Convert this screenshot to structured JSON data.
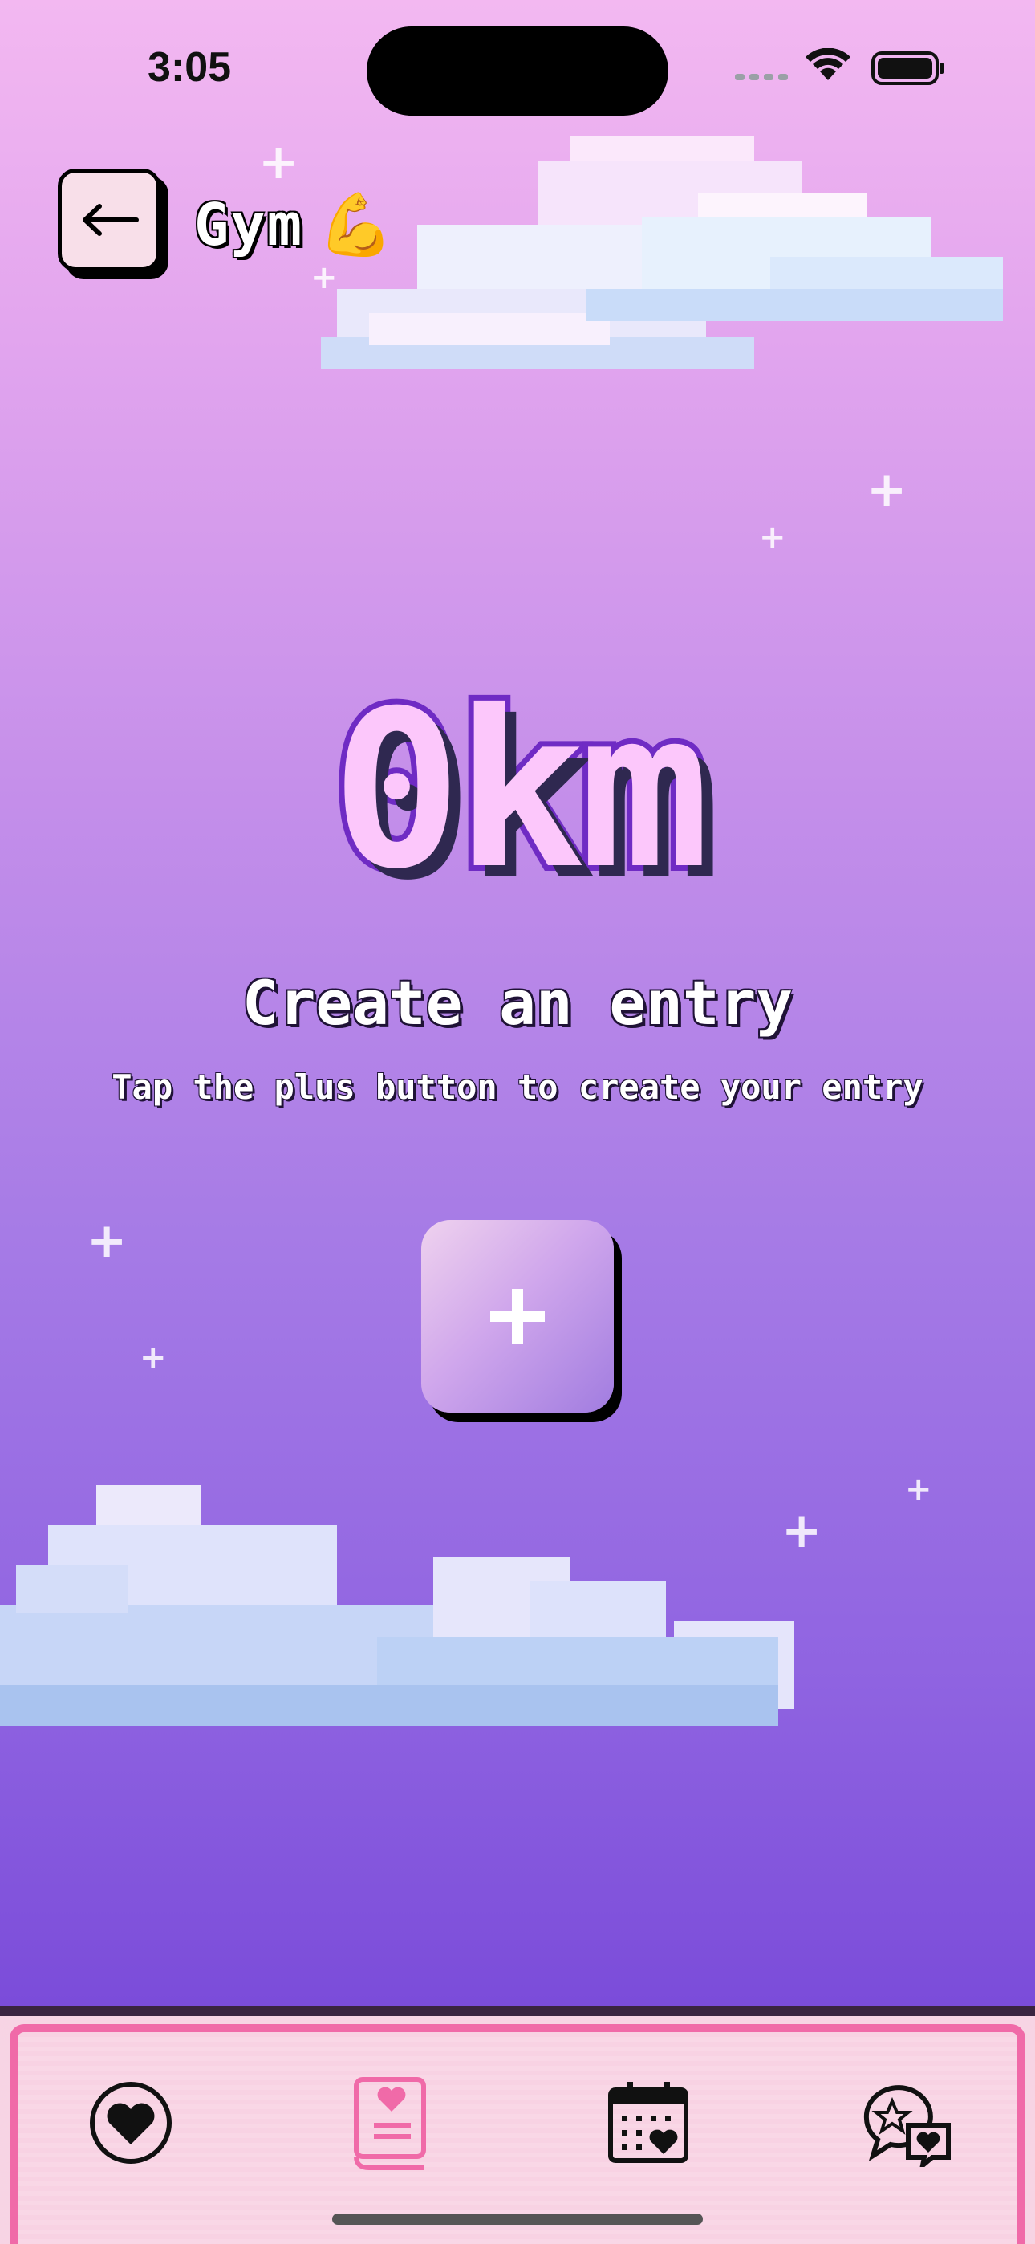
{
  "status_bar": {
    "time": "3:05"
  },
  "header": {
    "title": "Gym",
    "title_emoji": "💪",
    "back_icon": "arrow-left-icon"
  },
  "summary": {
    "distance": "0km"
  },
  "empty_state": {
    "title": "Create an entry",
    "subtitle": "Tap the plus button to create your entry"
  },
  "add_button": {
    "icon": "plus-icon"
  },
  "tabs": [
    {
      "icon": "heart-circle-icon",
      "active": false
    },
    {
      "icon": "heart-journal-icon",
      "active": true
    },
    {
      "icon": "calendar-heart-icon",
      "active": false
    },
    {
      "icon": "chat-heart-icon",
      "active": false
    }
  ],
  "colors": {
    "background_top": "#f3b8f1",
    "background_bottom": "#7545d6",
    "distance_fill": "#fcc7fb",
    "distance_outline": "#6f2bc4",
    "tab_bar": "#f8d2e3",
    "tab_bar_border": "#f06aa8",
    "active_tab": "#f06aa8"
  }
}
